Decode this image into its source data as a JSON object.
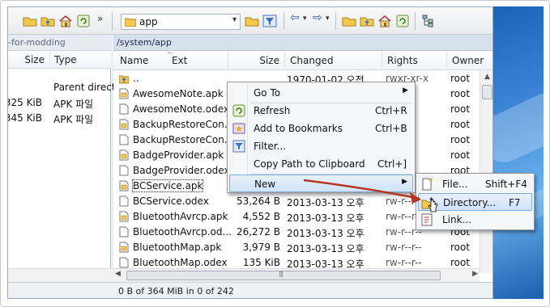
{
  "window": {
    "toolbar": {
      "overflow_glyph": "»",
      "path_value": "app",
      "path_dropdown_glyph": "▾",
      "nav_back_glyph": "⇦",
      "nav_forward_glyph": "⇨"
    },
    "left_pane": {
      "header": "-for-modding",
      "columns": {
        "size": "Size",
        "type": "Type"
      },
      "rows": [
        {
          "size": "",
          "type": "Parent direct"
        },
        {
          "size": "325 KiB",
          "type": "APK 파일"
        },
        {
          "size": "345 KiB",
          "type": "APK 파일"
        }
      ]
    },
    "right_pane": {
      "header": "/system/app",
      "columns": {
        "name": "Name",
        "ext": "Ext",
        "size": "Size",
        "changed": "Changed",
        "rights": "Rights",
        "owner": "Owner"
      },
      "rows": [
        {
          "name": "..",
          "size": "",
          "changed": "1970-01-02 오전",
          "rights": "rwxr-xr-x",
          "owner": "root",
          "icon": "parent-folder-icon"
        },
        {
          "name": "AwesomeNote.apk",
          "size": "",
          "changed": "",
          "rights": "",
          "owner": "root",
          "icon": "apk-file-icon"
        },
        {
          "name": "AwesomeNote.odex",
          "size": "",
          "changed": "",
          "rights": "",
          "owner": "root",
          "icon": "file-icon"
        },
        {
          "name": "BackupRestoreCon...",
          "size": "",
          "changed": "",
          "rights": "",
          "owner": "root",
          "icon": "apk-file-icon"
        },
        {
          "name": "BackupRestoreCon...",
          "size": "",
          "changed": "",
          "rights": "",
          "owner": "root",
          "icon": "file-icon"
        },
        {
          "name": "BadgeProvider.apk",
          "size": "",
          "changed": "",
          "rights": "",
          "owner": "root",
          "icon": "apk-file-icon"
        },
        {
          "name": "BadgeProvider.odex",
          "size": "",
          "changed": "",
          "rights": "",
          "owner": "root",
          "icon": "file-icon"
        },
        {
          "name": "BCService.apk",
          "size": "",
          "changed": "",
          "rights": "",
          "owner": "",
          "icon": "apk-file-icon",
          "selected": true
        },
        {
          "name": "BCService.odex",
          "size": "53,264 B",
          "changed": "2013-03-13 오후",
          "rights": "rw-r--r--",
          "owner": "root",
          "icon": "file-icon"
        },
        {
          "name": "BluetoothAvrcp.apk",
          "size": "4,552 B",
          "changed": "2013-03-13 오후",
          "rights": "rw-r--r--",
          "owner": "root",
          "icon": "apk-file-icon"
        },
        {
          "name": "BluetoothAvrcp.od...",
          "size": "26,272 B",
          "changed": "2013-03-13 오후",
          "rights": "rw-r--r--",
          "owner": "root",
          "icon": "file-icon"
        },
        {
          "name": "BluetoothMap.apk",
          "size": "3,979 B",
          "changed": "2013-03-13 오후",
          "rights": "rw-r--r--",
          "owner": "root",
          "icon": "apk-file-icon"
        },
        {
          "name": "BluetoothMap.odex",
          "size": "135 KiB",
          "changed": "2013-03-13 오후",
          "rights": "rw-r--r--",
          "owner": "root",
          "icon": "file-icon"
        }
      ]
    },
    "status_text": "0 B of 364 MiB in 0 of 242"
  },
  "context_menu": {
    "items": [
      {
        "label": "Go To",
        "shortcut": "",
        "icon": "",
        "submenu": true
      },
      {
        "label": "Refresh",
        "shortcut": "Ctrl+R",
        "icon": "refresh-icon"
      },
      {
        "label": "Add to Bookmarks",
        "shortcut": "Ctrl+B",
        "icon": "bookmark-icon"
      },
      {
        "label": "Filter...",
        "shortcut": "",
        "icon": "filter-icon"
      },
      {
        "label": "Copy Path to Clipboard",
        "shortcut": "Ctrl+]",
        "icon": ""
      },
      {
        "label": "New",
        "shortcut": "",
        "icon": "",
        "submenu": true,
        "highlighted": true
      }
    ],
    "submenu_glyph": "▶"
  },
  "new_submenu": {
    "items": [
      {
        "label": "File...",
        "shortcut": "Shift+F4",
        "icon": "new-file-icon"
      },
      {
        "label": "Directory...",
        "shortcut": "F7",
        "icon": "new-folder-icon",
        "highlighted": true
      },
      {
        "label": "Link...",
        "shortcut": "",
        "icon": "link-icon"
      }
    ]
  },
  "colors": {
    "accent_highlight": "#cfe3f9",
    "annotation_arrow": "#b5361e",
    "folder_yellow": "#f2c94c"
  }
}
